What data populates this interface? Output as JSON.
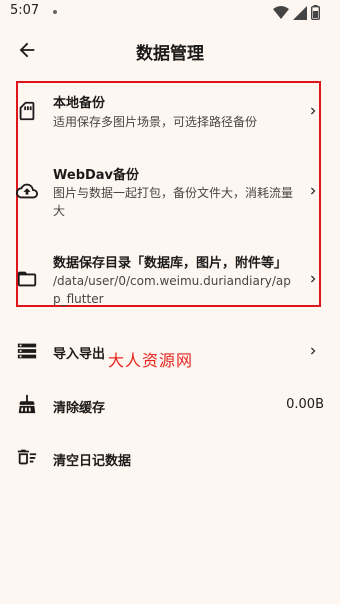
{
  "status_bar": {
    "time": "5:07"
  },
  "app_bar": {
    "title": "数据管理"
  },
  "items": [
    {
      "title": "本地备份",
      "subtitle": "适用保存多图片场景，可选择路径备份",
      "icon": "sd-card-icon"
    },
    {
      "title": "WebDav备份",
      "subtitle": "图片与数据一起打包，备份文件大，消耗流量大",
      "icon": "cloud-upload-icon"
    },
    {
      "title": "数据保存目录「数据库，图片，附件等」",
      "subtitle": "/data/user/0/com.weimu.duriandiary/app_flutter",
      "icon": "folder-icon"
    },
    {
      "title": "导入导出",
      "icon": "storage-icon"
    },
    {
      "title": "清除缓存",
      "value": "0.00B",
      "icon": "broom-icon"
    },
    {
      "title": "清空日记数据",
      "icon": "delete-sweep-icon"
    }
  ],
  "watermark": "大人资源网",
  "colors": {
    "background": "#FEF6F1",
    "highlight": "#E0141B",
    "watermark": "#E8251F"
  }
}
